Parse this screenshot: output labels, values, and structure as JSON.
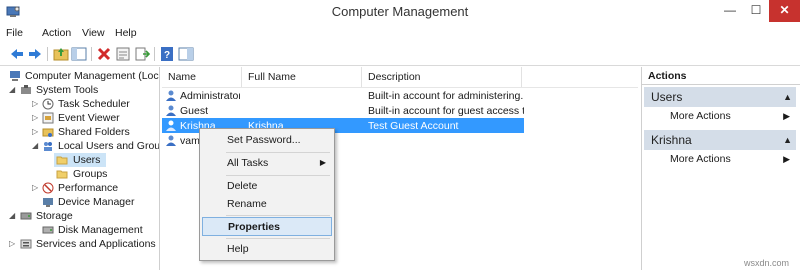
{
  "window": {
    "title": "Computer Management",
    "minimize": "—",
    "maximize": "☐",
    "close": "✕"
  },
  "menu": [
    "File",
    "Action",
    "View",
    "Help"
  ],
  "toolbar": {
    "icons": [
      "back-arrow-icon",
      "forward-arrow-icon",
      "up-folder-icon",
      "show-hide-tree-icon",
      "delete-icon",
      "properties-icon",
      "export-list-icon",
      "help-icon",
      "show-hide-action-pane-icon"
    ]
  },
  "tree": {
    "items": [
      {
        "label": "Computer Management (Local",
        "icon": "computer-icon"
      },
      {
        "label": "System Tools",
        "icon": "tools-icon"
      },
      {
        "label": "Task Scheduler",
        "icon": "clock-icon"
      },
      {
        "label": "Event Viewer",
        "icon": "event-viewer-icon"
      },
      {
        "label": "Shared Folders",
        "icon": "shared-folder-icon"
      },
      {
        "label": "Local Users and Groups",
        "icon": "users-groups-icon"
      },
      {
        "label": "Users",
        "icon": "folder-icon"
      },
      {
        "label": "Groups",
        "icon": "folder-icon"
      },
      {
        "label": "Performance",
        "icon": "performance-icon"
      },
      {
        "label": "Device Manager",
        "icon": "device-manager-icon"
      },
      {
        "label": "Storage",
        "icon": "storage-icon"
      },
      {
        "label": "Disk Management",
        "icon": "disk-icon"
      },
      {
        "label": "Services and Applications",
        "icon": "services-icon"
      }
    ]
  },
  "list": {
    "columns": [
      "Name",
      "Full Name",
      "Description"
    ],
    "rows": [
      {
        "name": "Administrator",
        "full_name": "",
        "description": "Built-in account for administering..."
      },
      {
        "name": "Guest",
        "full_name": "",
        "description": "Built-in account for guest access t..."
      },
      {
        "name": "Krishna",
        "full_name": "Krishna",
        "description": "Test Guest Account"
      },
      {
        "name": "vam",
        "full_name": "",
        "description": ""
      }
    ]
  },
  "context_menu": {
    "items": [
      "Set Password...",
      "All Tasks",
      "Delete",
      "Rename",
      "Properties",
      "Help"
    ],
    "submenu_arrow": "▶"
  },
  "actions": {
    "header": "Actions",
    "sections": [
      {
        "title": "Users",
        "more": "More Actions"
      },
      {
        "title": "Krishna",
        "more": "More Actions"
      }
    ],
    "collapse_caret": "▲",
    "more_arrow": "▶"
  },
  "watermark": "wsxdn.com",
  "colors": {
    "selected_row": "#3399ff",
    "close_button": "#c7322e",
    "action_section": "#d4dde8"
  }
}
